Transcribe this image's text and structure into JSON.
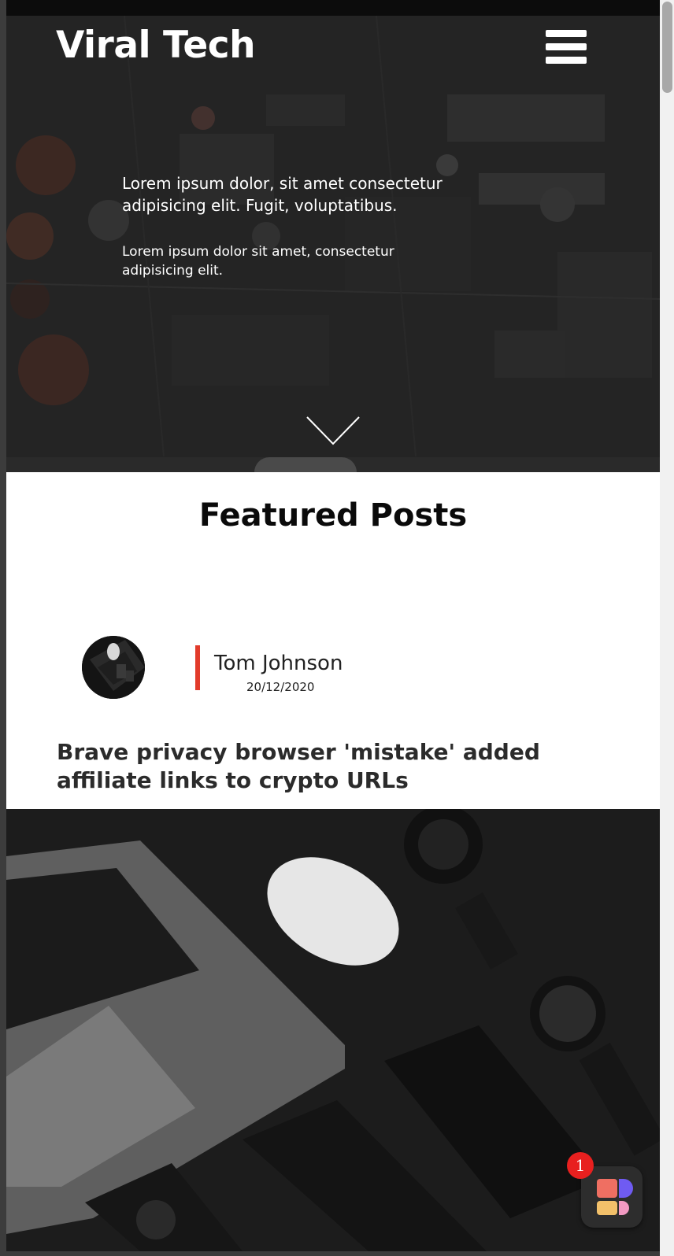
{
  "header": {
    "brand": "Viral Tech",
    "menu_icon": "hamburger-menu-icon"
  },
  "hero": {
    "headline": "Lorem ipsum dolor, sit amet consectetur adipisicing elit. Fugit, voluptatibus.",
    "subtext": "Lorem ipsum dolor sit amet, consectetur adipisicing elit.",
    "scroll_icon": "chevron-down-icon"
  },
  "featured": {
    "title": "Featured Posts",
    "post": {
      "author": "Tom Johnson",
      "date": "20/12/2020",
      "title": "Brave privacy browser 'mistake' added affiliate links to crypto URLs"
    }
  },
  "widget": {
    "badge_count": "1",
    "icon": "app-grid-icon"
  },
  "colors": {
    "accent": "#e23b2b",
    "badge": "#e8201f",
    "text_dark": "#2b2b2b",
    "white": "#ffffff"
  }
}
